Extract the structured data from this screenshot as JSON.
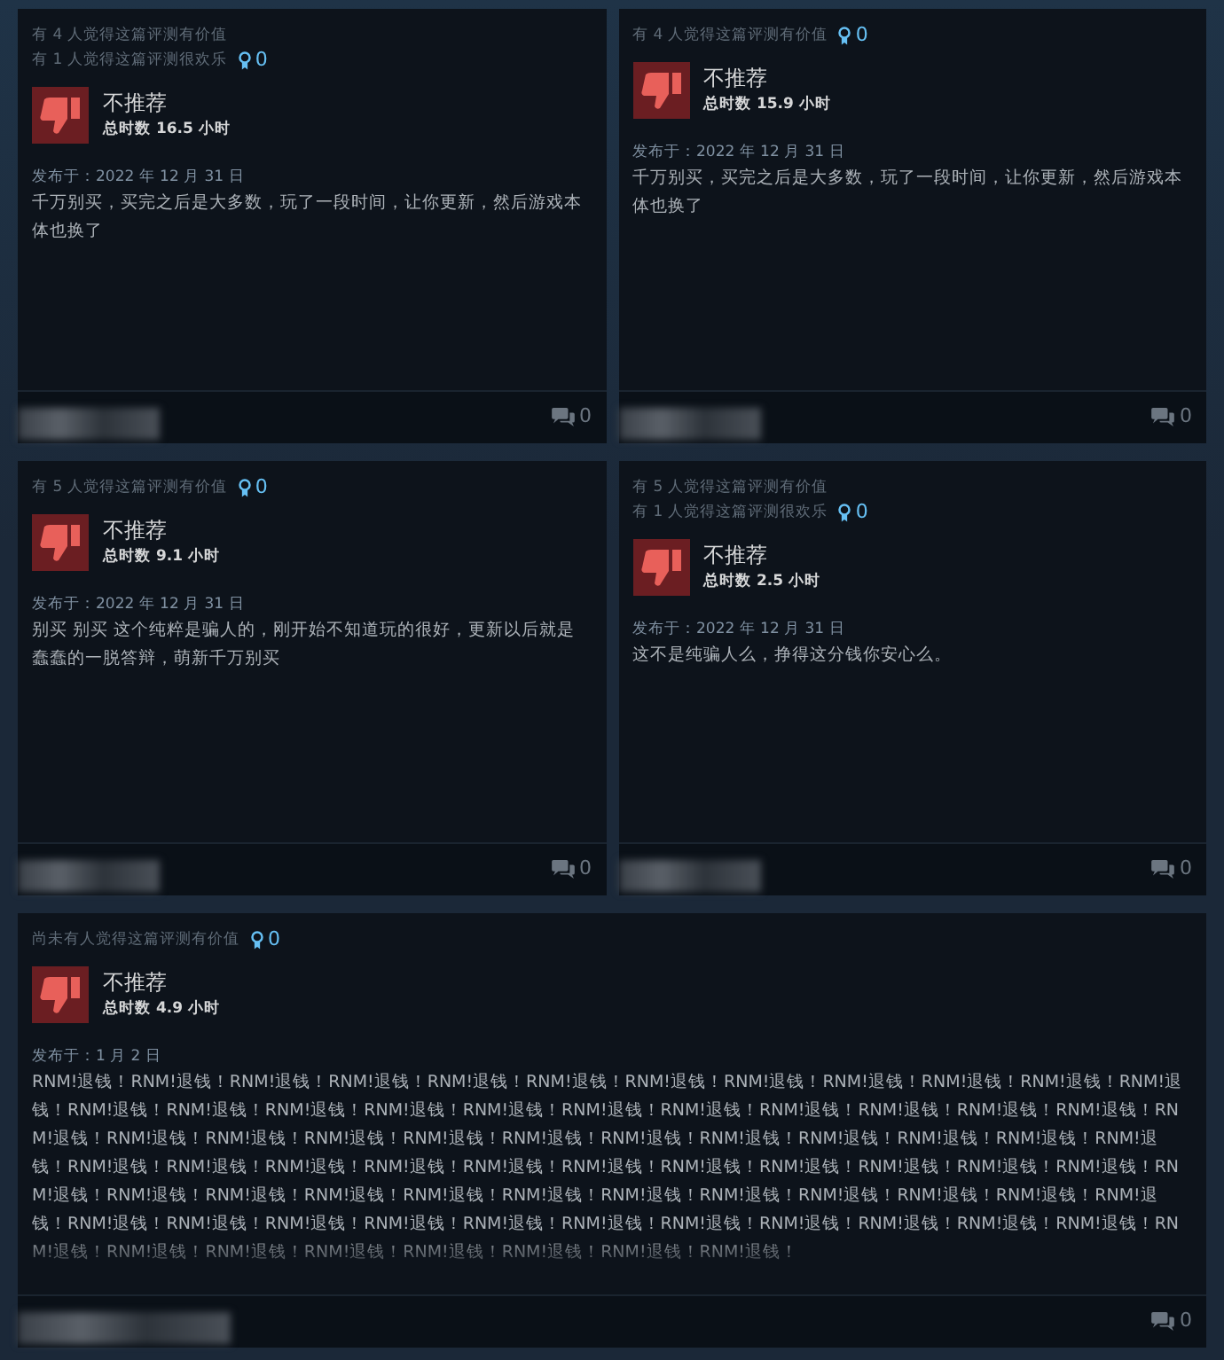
{
  "reviews": [
    {
      "helpful_lines": [
        "有 4 人觉得这篇评测有价值",
        "有 1 人觉得这篇评测很欢乐"
      ],
      "awards": "0",
      "recommended": false,
      "verdict": "不推荐",
      "hours": "总时数 16.5 小时",
      "posted": "发布于：2022 年 12 月 31 日",
      "body": "千万别买，买完之后是大多数，玩了一段时间，让你更新，然后游戏本体也换了",
      "comments": "0"
    },
    {
      "helpful_lines": [
        "有 4 人觉得这篇评测有价值"
      ],
      "awards": "0",
      "recommended": false,
      "verdict": "不推荐",
      "hours": "总时数 15.9 小时",
      "posted": "发布于：2022 年 12 月 31 日",
      "body": "千万别买，买完之后是大多数，玩了一段时间，让你更新，然后游戏本体也换了",
      "comments": "0"
    },
    {
      "helpful_lines": [
        "有 5 人觉得这篇评测有价值"
      ],
      "awards": "0",
      "recommended": false,
      "verdict": "不推荐",
      "hours": "总时数 9.1 小时",
      "posted": "发布于：2022 年 12 月 31 日",
      "body": "别买 别买 这个纯粹是骗人的，刚开始不知道玩的很好，更新以后就是蠢蠢的一脱答辩，萌新千万别买",
      "comments": "0"
    },
    {
      "helpful_lines": [
        "有 5 人觉得这篇评测有价值",
        "有 1 人觉得这篇评测很欢乐"
      ],
      "awards": "0",
      "recommended": false,
      "verdict": "不推荐",
      "hours": "总时数 2.5 小时",
      "posted": "发布于：2022 年 12 月 31 日",
      "body": "这不是纯骗人么，挣得这分钱你安心么。",
      "comments": "0"
    },
    {
      "helpful_lines": [
        "尚未有人觉得这篇评测有价值"
      ],
      "awards": "0",
      "recommended": false,
      "verdict": "不推荐",
      "hours": "总时数 4.9 小时",
      "posted": "发布于：1 月 2 日",
      "body": "RNM!退钱！RNM!退钱！RNM!退钱！RNM!退钱！RNM!退钱！RNM!退钱！RNM!退钱！RNM!退钱！RNM!退钱！RNM!退钱！RNM!退钱！RNM!退钱！RNM!退钱！RNM!退钱！RNM!退钱！RNM!退钱！RNM!退钱！RNM!退钱！RNM!退钱！RNM!退钱！RNM!退钱！RNM!退钱！RNM!退钱！RNM!退钱！RNM!退钱！RNM!退钱！RNM!退钱！RNM!退钱！RNM!退钱！RNM!退钱！RNM!退钱！RNM!退钱！RNM!退钱！RNM!退钱！RNM!退钱！RNM!退钱！RNM!退钱！RNM!退钱！RNM!退钱！RNM!退钱！RNM!退钱！RNM!退钱！RNM!退钱！RNM!退钱！RNM!退钱！RNM!退钱！RNM!退钱！RNM!退钱！RNM!退钱！RNM!退钱！RNM!退钱！RNM!退钱！RNM!退钱！RNM!退钱！RNM!退钱！RNM!退钱！RNM!退钱！RNM!退钱！RNM!退钱！RNM!退钱！RNM!退钱！RNM!退钱！RNM!退钱！RNM!退钱！RNM!退钱！RNM!退钱！RNM!退钱！RNM!退钱！RNM!退钱！RNM!退钱！RNM!退钱！RNM!退钱！RNM!退钱！RNM!退钱！RNM!退钱！RNM!退钱！RNM!退钱！",
      "faded": true,
      "comments": "0",
      "wide": true
    }
  ]
}
